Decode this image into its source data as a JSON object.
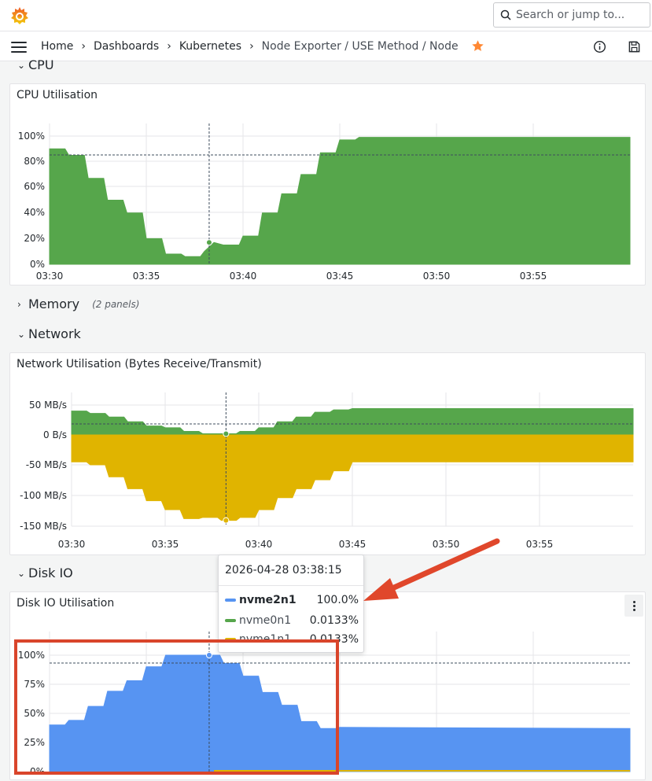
{
  "search": {
    "placeholder": "Search or jump to..."
  },
  "breadcrumb": {
    "items": [
      "Home",
      "Dashboards",
      "Kubernetes",
      "Node Exporter / USE Method / Node"
    ],
    "separator": "›"
  },
  "colors": {
    "green": "#56a64b",
    "yellow": "#e0b400",
    "blue": "#5794f2",
    "annotation": "#e0472b",
    "star": "#ff8833"
  },
  "rows": {
    "cpu": {
      "title": "CPU"
    },
    "memory": {
      "title": "Memory",
      "sub": "(2 panels)"
    },
    "network": {
      "title": "Network"
    },
    "disk": {
      "title": "Disk IO"
    }
  },
  "panels": {
    "cpu": {
      "title": "CPU Utilisation"
    },
    "network": {
      "title": "Network Utilisation (Bytes Receive/Transmit)"
    },
    "disk": {
      "title": "Disk IO Utilisation"
    }
  },
  "tooltip": {
    "time": "2026-04-28 03:38:15",
    "rows": [
      {
        "name": "nvme2n1",
        "value": "100.0%",
        "color": "#5794f2",
        "highlight": true
      },
      {
        "name": "nvme0n1",
        "value": "0.0133%",
        "color": "#56a64b",
        "highlight": false
      },
      {
        "name": "nvme1n1",
        "value": "0.0133%",
        "color": "#e0b400",
        "highlight": false
      }
    ]
  },
  "chart_data": [
    {
      "type": "area",
      "title": "CPU Utilisation",
      "x_ticks": [
        "03:30",
        "03:35",
        "03:40",
        "03:45",
        "03:50",
        "03:55"
      ],
      "y_ticks": [
        "0%",
        "20%",
        "40%",
        "60%",
        "80%",
        "100%"
      ],
      "ylim": [
        0,
        100
      ],
      "x_minutes": [
        0,
        0.8,
        1,
        1.8,
        2,
        2.8,
        3,
        3.8,
        4,
        4.8,
        5,
        5.8,
        6,
        6.8,
        7,
        7.8,
        8,
        8.5,
        9,
        9.8,
        10,
        10.8,
        11,
        11.8,
        12,
        12.8,
        13,
        13.8,
        14,
        14.8,
        15,
        15.8,
        16,
        16.8,
        17,
        30
      ],
      "series": [
        {
          "name": "CPU",
          "color": "#56a64b",
          "values": [
            90,
            90,
            85,
            85,
            67,
            67,
            50,
            50,
            40,
            40,
            20,
            20,
            8,
            8,
            6,
            6,
            10,
            17,
            15,
            15,
            22,
            22,
            40,
            40,
            55,
            55,
            70,
            70,
            87,
            87,
            97,
            97,
            99,
            99,
            99,
            99
          ]
        }
      ],
      "grid": true
    },
    {
      "type": "area",
      "title": "Network Utilisation (Bytes Receive/Transmit)",
      "x_ticks": [
        "03:30",
        "03:35",
        "03:40",
        "03:45",
        "03:50",
        "03:55"
      ],
      "y_ticks": [
        "50 MB/s",
        "0 B/s",
        "-50 MB/s",
        "-100 MB/s",
        "-150 MB/s"
      ],
      "ylim": [
        -155,
        60
      ],
      "x_minutes": [
        0,
        0.8,
        1,
        1.8,
        2,
        2.8,
        3,
        3.8,
        4,
        4.8,
        5,
        5.8,
        6,
        6.8,
        7,
        7.8,
        8,
        8.8,
        9,
        9.8,
        10,
        10.8,
        11,
        11.8,
        12,
        12.8,
        13,
        13.8,
        14,
        14.8,
        15,
        30
      ],
      "series": [
        {
          "name": "receive",
          "color": "#56a64b",
          "values": [
            40,
            40,
            36,
            36,
            30,
            30,
            22,
            22,
            15,
            15,
            12,
            12,
            6,
            6,
            2,
            2,
            2,
            2,
            6,
            6,
            12,
            12,
            22,
            22,
            30,
            30,
            38,
            38,
            42,
            42,
            44,
            44
          ]
        },
        {
          "name": "transmit",
          "color": "#e0b400",
          "values": [
            -45,
            -45,
            -50,
            -50,
            -70,
            -70,
            -90,
            -90,
            -110,
            -110,
            -125,
            -125,
            -140,
            -140,
            -138,
            -138,
            -143,
            -143,
            -138,
            -138,
            -125,
            -125,
            -105,
            -105,
            -90,
            -90,
            -75,
            -75,
            -60,
            -60,
            -45,
            -45
          ]
        }
      ],
      "grid": true
    },
    {
      "type": "area",
      "title": "Disk IO Utilisation",
      "x_ticks": [],
      "y_ticks": [
        "0%",
        "25%",
        "50%",
        "75%",
        "100%"
      ],
      "ylim": [
        0,
        100
      ],
      "x_minutes": [
        0,
        0.8,
        1,
        1.8,
        2,
        2.8,
        3,
        3.8,
        4,
        4.8,
        5,
        5.8,
        6,
        6.8,
        7,
        7.8,
        8,
        8.8,
        9,
        9.8,
        10,
        10.8,
        11,
        11.8,
        12,
        12.8,
        13,
        13.8,
        14,
        14.8,
        15,
        30
      ],
      "series": [
        {
          "name": "nvme2n1",
          "color": "#5794f2",
          "values": [
            40,
            40,
            44,
            44,
            56,
            56,
            69,
            69,
            78,
            78,
            90,
            90,
            100,
            100,
            100,
            100,
            100,
            100,
            93,
            93,
            82,
            82,
            68,
            68,
            57,
            57,
            43,
            43,
            37,
            37,
            38,
            37
          ]
        },
        {
          "name": "nvme0n1",
          "color": "#56a64b",
          "values": [
            0.0133
          ]
        },
        {
          "name": "nvme1n1",
          "color": "#e0b400",
          "values": [
            0.0133
          ]
        }
      ],
      "grid": true
    }
  ]
}
